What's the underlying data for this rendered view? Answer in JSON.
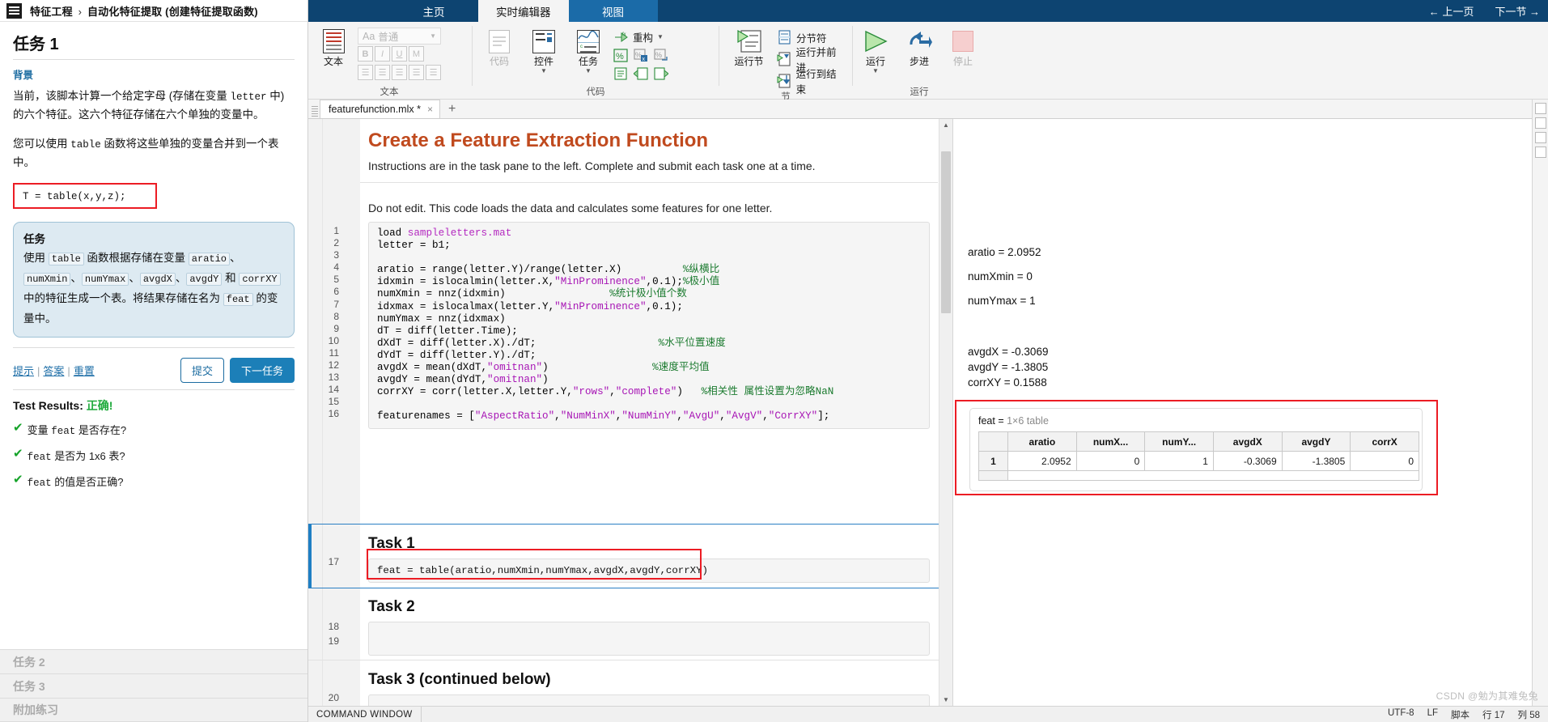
{
  "breadcrumb": {
    "root": "特征工程",
    "separator": "›",
    "current": "自动化特征提取 (创建特征提取函数)"
  },
  "task_pane": {
    "title": "任务 1",
    "background_heading": "背景",
    "paragraph_1": "当前，该脚本计算一个给定字母 (存储在变量 letter 中) 的六个特征。这六个特征存储在六个单独的变量中。",
    "paragraph_2": "您可以使用 table 函数将这些单独的变量合并到一个表中。",
    "example_code": "T = table(x,y,z);",
    "task_box": {
      "title": "任务",
      "text_parts": [
        "使用 ",
        "table",
        " 函数根据存储在变量 ",
        "aratio",
        "、",
        "numXmin",
        "、",
        "numYmax",
        "、",
        "avgdX",
        "、",
        "avgdY",
        " 和 ",
        "corrXY",
        " 中的特征生成一个表。将结果存储在名为 ",
        "feat",
        " 的变量中。"
      ],
      "full_text": "使用 table 函数根据存储在变量 aratio、numXmin、numYmax、avgdX、avgdY 和 corrXY 中的特征生成一个表。将结果存储在名为 feat 的变量中。"
    },
    "links": {
      "hint": "提示",
      "answer": "答案",
      "reset": "重置"
    },
    "buttons": {
      "submit": "提交",
      "next": "下一任务"
    },
    "test_results": {
      "label": "Test Results:",
      "status": "正确!",
      "status_color": "#16a32a"
    },
    "tests": [
      "变量 feat 是否存在?",
      "feat 是否为 1x6 表?",
      "feat 的值是否正确?"
    ],
    "other_tasks": [
      "任务 2",
      "任务 3",
      "附加练习"
    ]
  },
  "ribbon": {
    "tabs": [
      {
        "label": "主页",
        "state": "normal"
      },
      {
        "label": "实时编辑器",
        "state": "active"
      },
      {
        "label": "视图",
        "state": "highlight"
      }
    ],
    "top_right": [
      "← 上一页",
      "下一节 →"
    ],
    "groups": [
      {
        "name": "文本",
        "label": "文本",
        "big_button": "文本",
        "style_dropdown": "普通",
        "style_prefix": "Aa",
        "format_buttons": [
          "B",
          "I",
          "U",
          "M"
        ],
        "list_buttons": [
          "bulleted-list",
          "numbered-list",
          "align-left",
          "align-center",
          "align-right"
        ]
      },
      {
        "name": "代码",
        "label": "代码",
        "buttons": [
          {
            "caption": "代码",
            "dim": true
          },
          {
            "caption": "控件",
            "dim": false,
            "has_dropdown": true
          },
          {
            "caption": "任务",
            "dim": false,
            "has_dropdown": true
          }
        ],
        "refactor_label": "重构",
        "small_icons": [
          "percent",
          "percent-delete",
          "percent-copy",
          "indent",
          "increase-indent",
          "decrease-indent"
        ]
      },
      {
        "name": "节",
        "label": "节",
        "big_button": "运行节",
        "items": [
          "分节符",
          "运行并前进",
          "运行到结束"
        ]
      },
      {
        "name": "运行",
        "label": "运行",
        "items": [
          {
            "caption": "运行",
            "dim": false,
            "has_dropdown": true
          },
          {
            "caption": "步进",
            "dim": false
          },
          {
            "caption": "停止",
            "dim": true
          }
        ]
      }
    ]
  },
  "document": {
    "tab_name": "featurefunction.mlx *",
    "tab_close": "×",
    "new_tab": "+",
    "heading": "Create a Feature Extraction Function",
    "intro": "Instructions are in the task pane to the left. Complete and submit each task one at a time.",
    "note": "Do not edit. This code loads the data and calculates some features for one letter.",
    "code_lines": [
      {
        "n": "1",
        "segments": [
          {
            "t": "load ",
            "c": "plain"
          },
          {
            "t": "sampleletters.mat",
            "c": "file"
          }
        ]
      },
      {
        "n": "2",
        "segments": [
          {
            "t": "letter = b1;",
            "c": "plain"
          }
        ]
      },
      {
        "n": "3",
        "segments": [
          {
            "t": "",
            "c": "plain"
          }
        ]
      },
      {
        "n": "4",
        "segments": [
          {
            "t": "aratio = range(letter.Y)/range(letter.X)          ",
            "c": "plain"
          },
          {
            "t": "%纵横比",
            "c": "comment"
          }
        ]
      },
      {
        "n": "5",
        "segments": [
          {
            "t": "idxmin = islocalmin(letter.X,",
            "c": "plain"
          },
          {
            "t": "\"MinProminence\"",
            "c": "string"
          },
          {
            "t": ",0.1);",
            "c": "plain"
          },
          {
            "t": "%极小值",
            "c": "comment"
          }
        ]
      },
      {
        "n": "6",
        "segments": [
          {
            "t": "numXmin = nnz(idxmin)                 ",
            "c": "plain"
          },
          {
            "t": "%统计极小值个数",
            "c": "comment"
          }
        ]
      },
      {
        "n": "7",
        "segments": [
          {
            "t": "idxmax = islocalmax(letter.Y,",
            "c": "plain"
          },
          {
            "t": "\"MinProminence\"",
            "c": "string"
          },
          {
            "t": ",0.1);",
            "c": "plain"
          }
        ]
      },
      {
        "n": "8",
        "segments": [
          {
            "t": "numYmax = nnz(idxmax)",
            "c": "plain"
          }
        ]
      },
      {
        "n": "9",
        "segments": [
          {
            "t": "dT = diff(letter.Time);",
            "c": "plain"
          }
        ]
      },
      {
        "n": "10",
        "segments": [
          {
            "t": "dXdT = diff(letter.X)./dT;                    ",
            "c": "plain"
          },
          {
            "t": "%水平位置速度",
            "c": "comment"
          }
        ]
      },
      {
        "n": "11",
        "segments": [
          {
            "t": "dYdT = diff(letter.Y)./dT;",
            "c": "plain"
          }
        ]
      },
      {
        "n": "12",
        "segments": [
          {
            "t": "avgdX = mean(dXdT,",
            "c": "plain"
          },
          {
            "t": "\"omitnan\"",
            "c": "string"
          },
          {
            "t": ")                 ",
            "c": "plain"
          },
          {
            "t": "%速度平均值",
            "c": "comment"
          }
        ]
      },
      {
        "n": "13",
        "segments": [
          {
            "t": "avgdY = mean(dYdT,",
            "c": "plain"
          },
          {
            "t": "\"omitnan\"",
            "c": "string"
          },
          {
            "t": ")",
            "c": "plain"
          }
        ]
      },
      {
        "n": "14",
        "segments": [
          {
            "t": "corrXY = corr(letter.X,letter.Y,",
            "c": "plain"
          },
          {
            "t": "\"rows\"",
            "c": "string"
          },
          {
            "t": ",",
            "c": "plain"
          },
          {
            "t": "\"complete\"",
            "c": "string"
          },
          {
            "t": ")   ",
            "c": "plain"
          },
          {
            "t": "%相关性 属性设置为忽略NaN",
            "c": "comment"
          }
        ]
      },
      {
        "n": "15",
        "segments": [
          {
            "t": "",
            "c": "plain"
          }
        ]
      },
      {
        "n": "16",
        "segments": [
          {
            "t": "featurenames = [",
            "c": "plain"
          },
          {
            "t": "\"AspectRatio\"",
            "c": "string"
          },
          {
            "t": ",",
            "c": "plain"
          },
          {
            "t": "\"NumMinX\"",
            "c": "string"
          },
          {
            "t": ",",
            "c": "plain"
          },
          {
            "t": "\"NumMinY\"",
            "c": "string"
          },
          {
            "t": ",",
            "c": "plain"
          },
          {
            "t": "\"AvgU\"",
            "c": "string"
          },
          {
            "t": ",",
            "c": "plain"
          },
          {
            "t": "\"AvgV\"",
            "c": "string"
          },
          {
            "t": ",",
            "c": "plain"
          },
          {
            "t": "\"CorrXY\"",
            "c": "string"
          },
          {
            "t": "];",
            "c": "plain"
          }
        ]
      }
    ],
    "tasks": [
      {
        "heading": "Task 1",
        "line_numbers": [
          "17"
        ],
        "code": "feat = table(aratio,numXmin,numYmax,avgdX,avgdY,corrXY)",
        "highlighted": true
      },
      {
        "heading": "Task 2",
        "line_numbers": [
          "18",
          "19"
        ],
        "code": "",
        "highlighted": false
      },
      {
        "heading": "Task 3 (continued below)",
        "line_numbers": [
          "20"
        ],
        "code": "",
        "highlighted": false
      }
    ]
  },
  "output": {
    "scalars_group_1": [
      {
        "name": "aratio",
        "value": "2.0952"
      },
      {
        "name": "numXmin",
        "value": "0"
      },
      {
        "name": "numYmax",
        "value": "1"
      }
    ],
    "scalars_group_2": [
      {
        "name": "avgdX",
        "value": "-0.3069"
      },
      {
        "name": "avgdY",
        "value": "-1.3805"
      },
      {
        "name": "corrXY",
        "value": "0.1588"
      }
    ],
    "table": {
      "title_name": "feat =",
      "title_dim": "1×6 table",
      "columns": [
        "aratio",
        "numX...",
        "numY...",
        "avgdX",
        "avgdY",
        "corrX"
      ],
      "row_index": "1",
      "row_values": [
        "2.0952",
        "0",
        "1",
        "-0.3069",
        "-1.3805",
        "0"
      ]
    }
  },
  "status_bar": {
    "command_window": "COMMAND WINDOW",
    "right_items": [
      "UTF-8",
      "LF",
      "脚本",
      "行 17",
      "列 58"
    ]
  },
  "watermark": "CSDN @勉为其难兔兔",
  "colors": {
    "ribbon_blue": "#0d4471",
    "tab_highlight": "#1b6ba8",
    "accent_red": "#ec1c24",
    "heading_orange": "#c04a1e",
    "link_blue": "#1f6fa8",
    "success_green": "#16a32a",
    "task_box_bg": "#ddeaf2",
    "comment_green": "#1a7a2e",
    "string_purple": "#a715b5"
  }
}
